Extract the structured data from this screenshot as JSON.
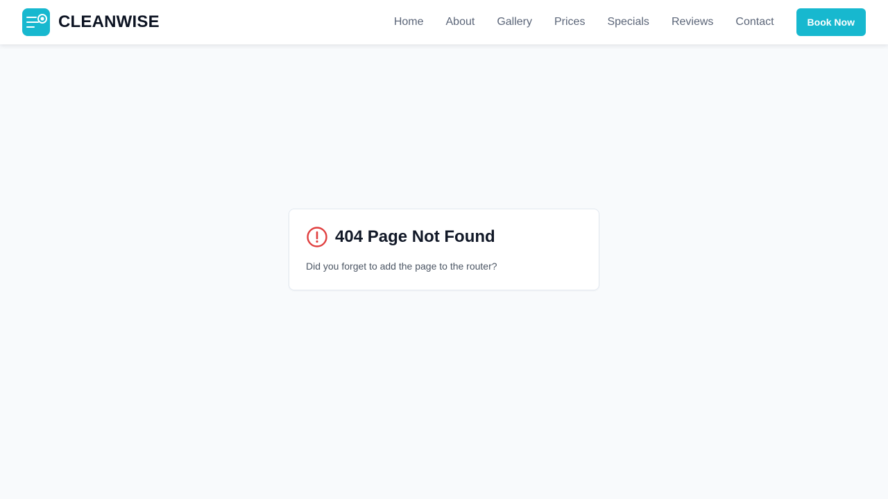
{
  "brand": {
    "name": "CLEANWISE",
    "logo_icon": "cleaning-logo-icon",
    "accent_color": "#17b8cf"
  },
  "nav": {
    "links": [
      "Home",
      "About",
      "Gallery",
      "Prices",
      "Specials",
      "Reviews",
      "Contact"
    ],
    "cta_label": "Book Now"
  },
  "error": {
    "icon": "alert-circle-icon",
    "icon_color": "#e03e3e",
    "title": "404 Page Not Found",
    "message": "Did you forget to add the page to the router?"
  }
}
